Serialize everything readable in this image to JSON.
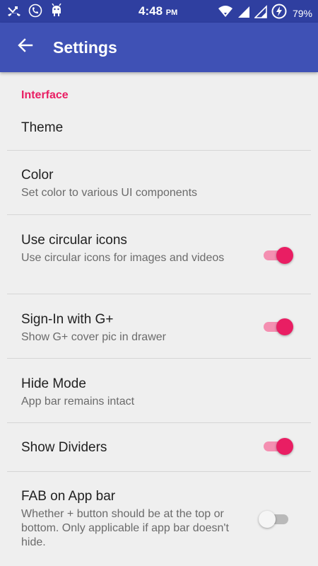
{
  "status_bar": {
    "time": "4:48",
    "ampm": "PM",
    "battery": "79%",
    "left_icons": [
      "missed-call-icon",
      "call-icon",
      "android-debug-icon"
    ],
    "right_icons": [
      "wifi-icon",
      "signal-icon",
      "signal-icon-2",
      "battery-charging-icon"
    ]
  },
  "app_bar": {
    "title": "Settings",
    "back_icon": "arrow-left-icon"
  },
  "settings": {
    "section_header": "Interface",
    "items": [
      {
        "title": "Theme",
        "subtitle": ""
      },
      {
        "title": "Color",
        "subtitle": "Set color to various UI components"
      },
      {
        "title": "Use circular icons",
        "subtitle": "Use circular icons for images and videos",
        "toggle": true
      },
      {
        "title": "Sign-In with G+",
        "subtitle": "Show G+ cover pic in drawer",
        "toggle": true
      },
      {
        "title": "Hide Mode",
        "subtitle": "App bar remains intact"
      },
      {
        "title": "Show Dividers",
        "subtitle": "",
        "toggle": true
      },
      {
        "title": "FAB on App bar",
        "subtitle": "Whether + button should be at the top or bottom. Only applicable if app bar doesn't hide.",
        "toggle": false
      }
    ]
  },
  "colors": {
    "app_bar": "#3f51b5",
    "status_bar": "#2f3fa0",
    "accent": "#e91e63",
    "background": "#efefef"
  }
}
